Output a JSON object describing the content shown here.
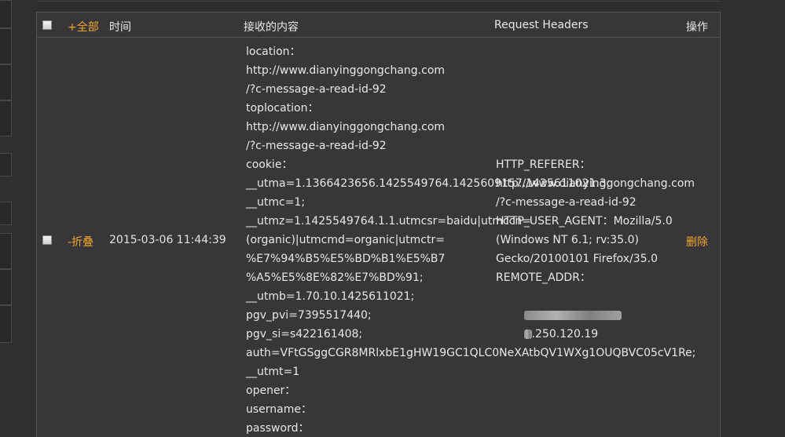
{
  "header": {
    "expand_all": "+全部",
    "time": "时间",
    "content": "接收的内容",
    "request_headers": "Request Headers",
    "actions": "操作"
  },
  "row": {
    "toggle": "-折叠",
    "time": "2015-03-06 11:44:39",
    "delete": "删除",
    "content_lines": [
      "location：",
      "http://www.dianyinggongchang.com",
      "/?c-message-a-read-id-92",
      "toplocation：",
      "http://www.dianyinggongchang.com",
      "/?c-message-a-read-id-92",
      "cookie：",
      "__utma=1.1366423656.1425549764.1425609157.1425611021.3;",
      "__utmc=1;",
      "__utmz=1.1425549764.1.1.utmcsr=baidu|utmccn=",
      "(organic)|utmcmd=organic|utmctr=",
      "%E7%94%B5%E5%BD%B1%E5%B7",
      "%A5%E5%8E%82%E7%BD%91;",
      "__utmb=1.70.10.1425611021;",
      "pgv_pvi=7395517440;",
      "pgv_si=s422161408;",
      "auth=VFtGSggCGR8MRlxbE1gHW19GC1QLC0NeXAtbQV1WXg1OUQBVC05cV1Re;",
      "__utmt=1",
      "opener：",
      "username：",
      "password："
    ],
    "headers_lines": [
      "HTTP_REFERER：",
      "http://www.dianyinggongchang.com",
      "/?c-message-a-read-id-92",
      "HTTP_USER_AGENT：Mozilla/5.0",
      "(Windows NT 6.1; rv:35.0)",
      "Gecko/20100101 Firefox/35.0",
      "REMOTE_ADDR："
    ],
    "remote_addr_partial": ".250.120.19"
  },
  "colors": {
    "accent": "#f0a830",
    "panel_bg": "#383638",
    "page_bg": "#302e30",
    "border": "#555355"
  }
}
